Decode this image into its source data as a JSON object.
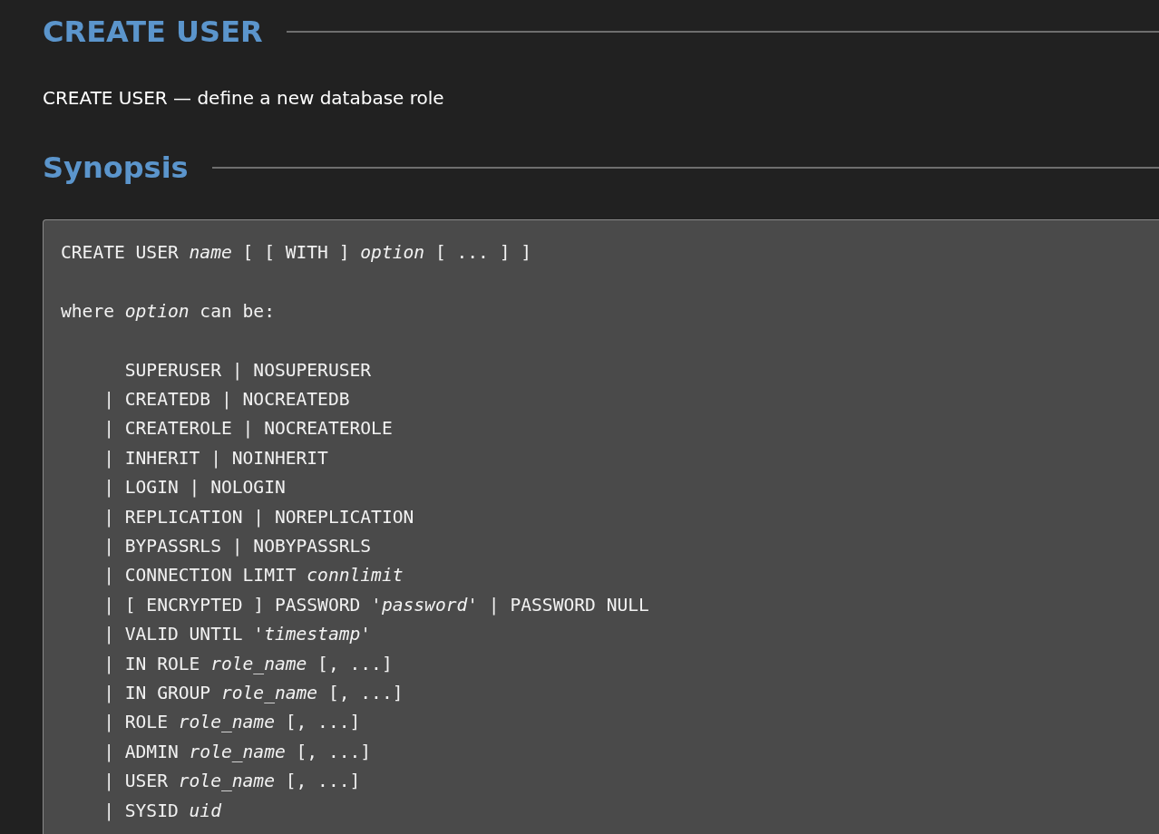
{
  "title": "CREATE USER",
  "description": "CREATE USER — define a new database role",
  "synopsis": {
    "heading": "Synopsis",
    "code": [
      [
        "CREATE USER *name* [ [ WITH ] *option* [ ... ] ]"
      ],
      [
        "where *option* can be:"
      ],
      [
        "      SUPERUSER | NOSUPERUSER",
        "    | CREATEDB | NOCREATEDB",
        "    | CREATEROLE | NOCREATEROLE",
        "    | INHERIT | NOINHERIT",
        "    | LOGIN | NOLOGIN",
        "    | REPLICATION | NOREPLICATION",
        "    | BYPASSRLS | NOBYPASSRLS",
        "    | CONNECTION LIMIT *connlimit*",
        "    | [ ENCRYPTED ] PASSWORD '*password*' | PASSWORD NULL",
        "    | VALID UNTIL '*timestamp*'",
        "    | IN ROLE *role_name* [, ...]",
        "    | IN GROUP *role_name* [, ...]",
        "    | ROLE *role_name* [, ...]",
        "    | ADMIN *role_name* [, ...]",
        "    | USER *role_name* [, ...]",
        "    | SYSID *uid*"
      ]
    ]
  }
}
